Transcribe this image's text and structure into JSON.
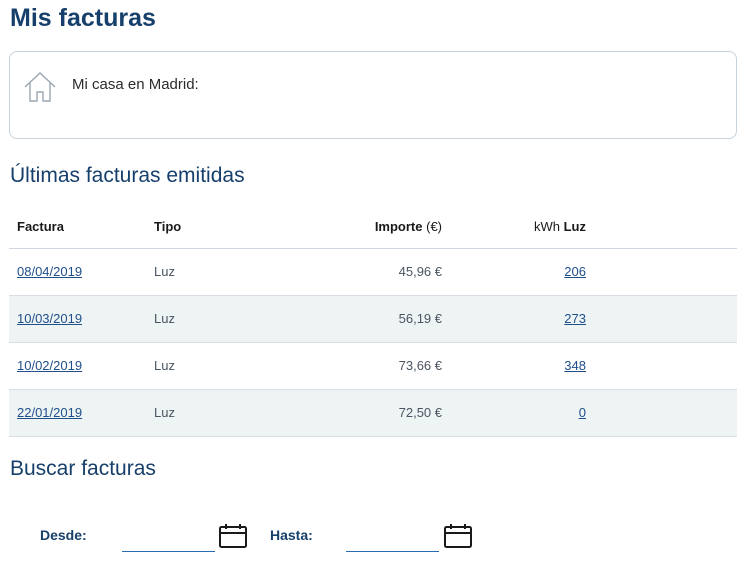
{
  "page": {
    "title": "Mis facturas"
  },
  "address": {
    "label": "Mi casa en Madrid:"
  },
  "invoices": {
    "title": "Últimas facturas emitidas",
    "headers": {
      "factura": "Factura",
      "tipo": "Tipo",
      "importe": "Importe",
      "importe_unit": "(€)",
      "kwh_prefix": "kWh",
      "kwh_bold": "Luz"
    },
    "rows": [
      {
        "date": "08/04/2019",
        "type": "Luz",
        "amount": "45,96 €",
        "kwh": "206"
      },
      {
        "date": "10/03/2019",
        "type": "Luz",
        "amount": "56,19 €",
        "kwh": "273"
      },
      {
        "date": "10/02/2019",
        "type": "Luz",
        "amount": "73,66 €",
        "kwh": "348"
      },
      {
        "date": "22/01/2019",
        "type": "Luz",
        "amount": "72,50 €",
        "kwh": "0"
      }
    ]
  },
  "search": {
    "title": "Buscar facturas",
    "from_label": "Desde:",
    "from_value": "",
    "to_label": "Hasta:",
    "to_value": ""
  },
  "icons": {
    "house": "house-icon",
    "calendar": "calendar-icon"
  },
  "colors": {
    "primary": "#173f6b",
    "link": "#1f4f8a",
    "row_alt": "#eef3f4"
  }
}
